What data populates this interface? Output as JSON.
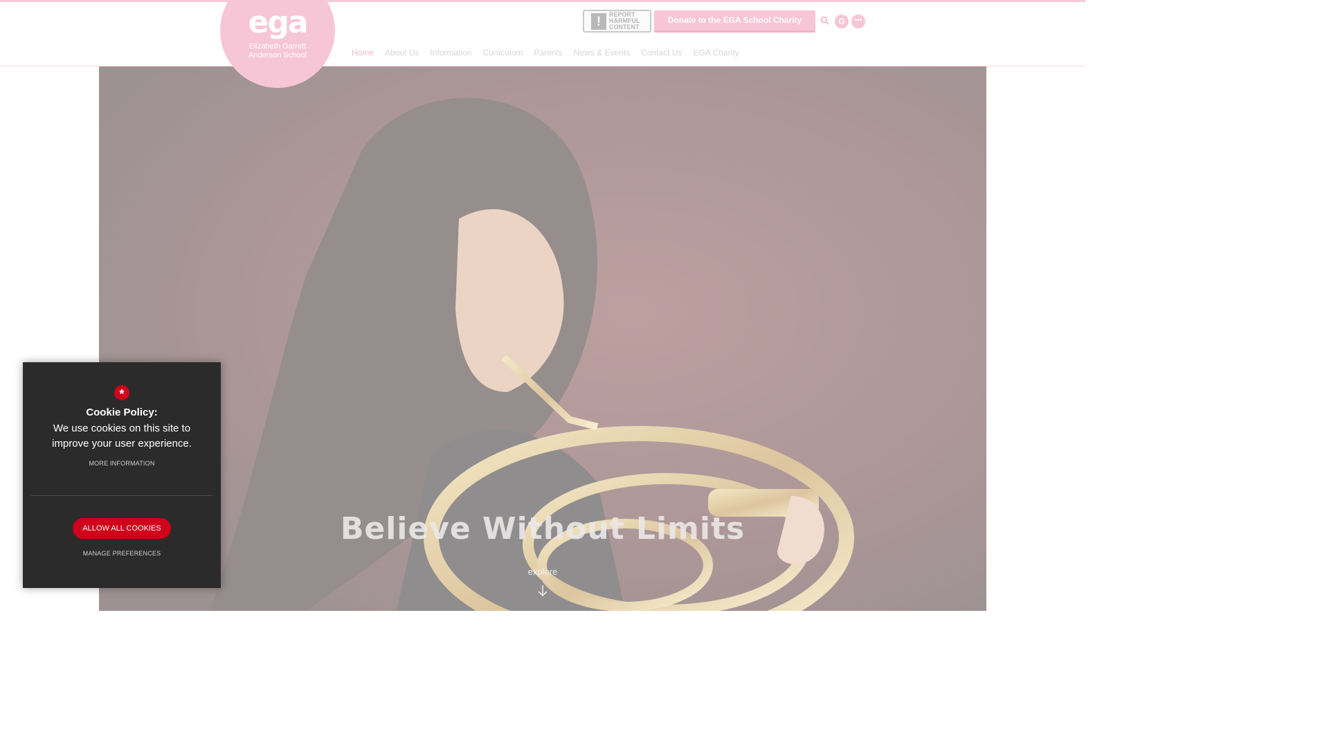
{
  "header": {
    "logo": {
      "mark": "ega",
      "name_line1": "Elizabeth Garrett",
      "name_line2": "Anderson School"
    },
    "report_button": {
      "line1": "REPORT",
      "line2": "HARMFUL",
      "line3": "CONTENT",
      "icon": "exclamation-icon"
    },
    "donate_label": "Donate to the EGA School Charity",
    "search_icon": "search-icon",
    "google_translate_label": "G",
    "more_label": "•••",
    "nav": [
      {
        "label": "Home",
        "active": true
      },
      {
        "label": "About Us",
        "active": false
      },
      {
        "label": "Information",
        "active": false
      },
      {
        "label": "Curriculum",
        "active": false
      },
      {
        "label": "Parents",
        "active": false
      },
      {
        "label": "News & Events",
        "active": false
      },
      {
        "label": "Contact Us",
        "active": false
      },
      {
        "label": "EGA Charity",
        "active": false
      }
    ]
  },
  "hero": {
    "title": "Believe Without Limits",
    "explore_label": "explore",
    "explore_icon": "arrow-down-icon"
  },
  "cookie_banner": {
    "icon_glyph": "*",
    "title": "Cookie Policy:",
    "body": "We use cookies on this site to improve your user experience.",
    "more_info_label": "MORE INFORMATION",
    "allow_label": "ALLOW ALL COOKIES",
    "manage_label": "MANAGE PREFERENCES"
  },
  "colors": {
    "brand_pink": "#f7c6d6",
    "nav_active": "#f4b8cc",
    "cookie_bg": "#2b2b2b",
    "cookie_accent": "#d0021b"
  }
}
